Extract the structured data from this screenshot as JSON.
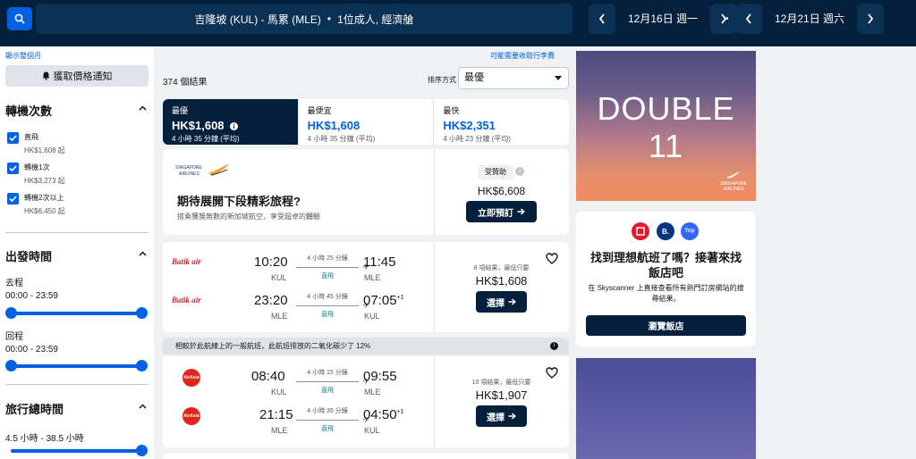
{
  "header": {
    "search_text": "吉隆坡 (KUL) - 馬累 (MLE)",
    "passenger_text": "1位成人, 經濟艙",
    "separator": "•",
    "depart_date": "12月16日 週一",
    "return_date": "12月21日 週六"
  },
  "top_links": {
    "show_full_month": "顯示整個月",
    "baggage_fees": "可能需要收取行李費"
  },
  "sidebar": {
    "price_alert_label": "獲取價格通知",
    "stops": {
      "title": "轉機次數",
      "items": [
        {
          "label": "直飛",
          "price": "HK$1,608 起",
          "checked": true
        },
        {
          "label": "轉機1次",
          "price": "HK$3,273 起",
          "checked": true
        },
        {
          "label": "轉機2次以上",
          "price": "HK$6,450 起",
          "checked": true
        }
      ]
    },
    "departure_time": {
      "title": "出發時間",
      "outbound_label": "去程",
      "outbound_range": "00:00 - 23:59",
      "return_label": "回程",
      "return_range": "00:00 - 23:59"
    },
    "duration": {
      "title": "旅行總時間",
      "range": "4.5 小時 - 38.5 小時"
    }
  },
  "results": {
    "count_text": "374 個結果",
    "sort_label": "排序方式",
    "sort_value": "最優"
  },
  "tabs": [
    {
      "name": "最優",
      "price": "HK$1,608",
      "duration": "4 小時 35 分鐘 (平均)",
      "active": true
    },
    {
      "name": "最便宜",
      "price": "HK$1,608",
      "duration": "4 小時 35 分鐘 (平均)",
      "active": false
    },
    {
      "name": "最快",
      "price": "HK$2,351",
      "duration": "4 小時 23 分鐘 (平均)",
      "active": false
    }
  ],
  "ad_card": {
    "logo_line1": "SINGAPORE",
    "logo_line2": "AIRLINES",
    "title": "期待展開下段精彩旅程?",
    "description": "搭乘獲獎無數的新加坡航空，享受超卓的體驗",
    "sponsored": "受贊助",
    "price": "HK$6,608",
    "button": "立即預訂"
  },
  "flights": [
    {
      "airline": "Batik air",
      "legs": [
        {
          "dep_time": "10:20",
          "dep_code": "KUL",
          "duration": "4 小時 25 分鐘",
          "stops": "直飛",
          "arr_time": "11:45",
          "arr_code": "MLE",
          "plus": ""
        },
        {
          "dep_time": "23:20",
          "dep_code": "MLE",
          "duration": "4 小時 45 分鐘",
          "stops": "直飛",
          "arr_time": "07:05",
          "arr_code": "KUL",
          "plus": "+1"
        }
      ],
      "deal_note": "8 項結果，最低只要",
      "price": "HK$1,608",
      "button": "選擇"
    },
    {
      "airline": "AirAsia",
      "legs": [
        {
          "dep_time": "08:40",
          "dep_code": "KUL",
          "duration": "4 小時 15 分鐘",
          "stops": "直飛",
          "arr_time": "09:55",
          "arr_code": "MLE",
          "plus": ""
        },
        {
          "dep_time": "21:15",
          "dep_code": "MLE",
          "duration": "4 小時 35 分鐘",
          "stops": "直飛",
          "arr_time": "04:50",
          "arr_code": "KUL",
          "plus": "+1"
        }
      ],
      "deal_note": "10 項結果，最低只要",
      "price": "HK$1,907",
      "button": "選擇"
    }
  ],
  "co2_banner": "相較於此航線上的一般航班，此航班排放的二氧化碳少了 12%",
  "right_ad": {
    "headline": "DOUBLE 11",
    "logo_line1": "SINGAPORE",
    "logo_line2": "AIRLINES"
  },
  "hotel_card": {
    "logo_b": "B.",
    "logo_trip": "Trip",
    "title": "找到理想航班了嗎？接著來找飯店吧",
    "description": "在 Skyscanner 上直接查看所有熱門訂房網站的搜尋結果。",
    "button": "瀏覽飯店"
  },
  "colors": {
    "brand_dark": "#05203c",
    "brand_blue": "#0062e3",
    "stops_teal": "#0c838a"
  }
}
